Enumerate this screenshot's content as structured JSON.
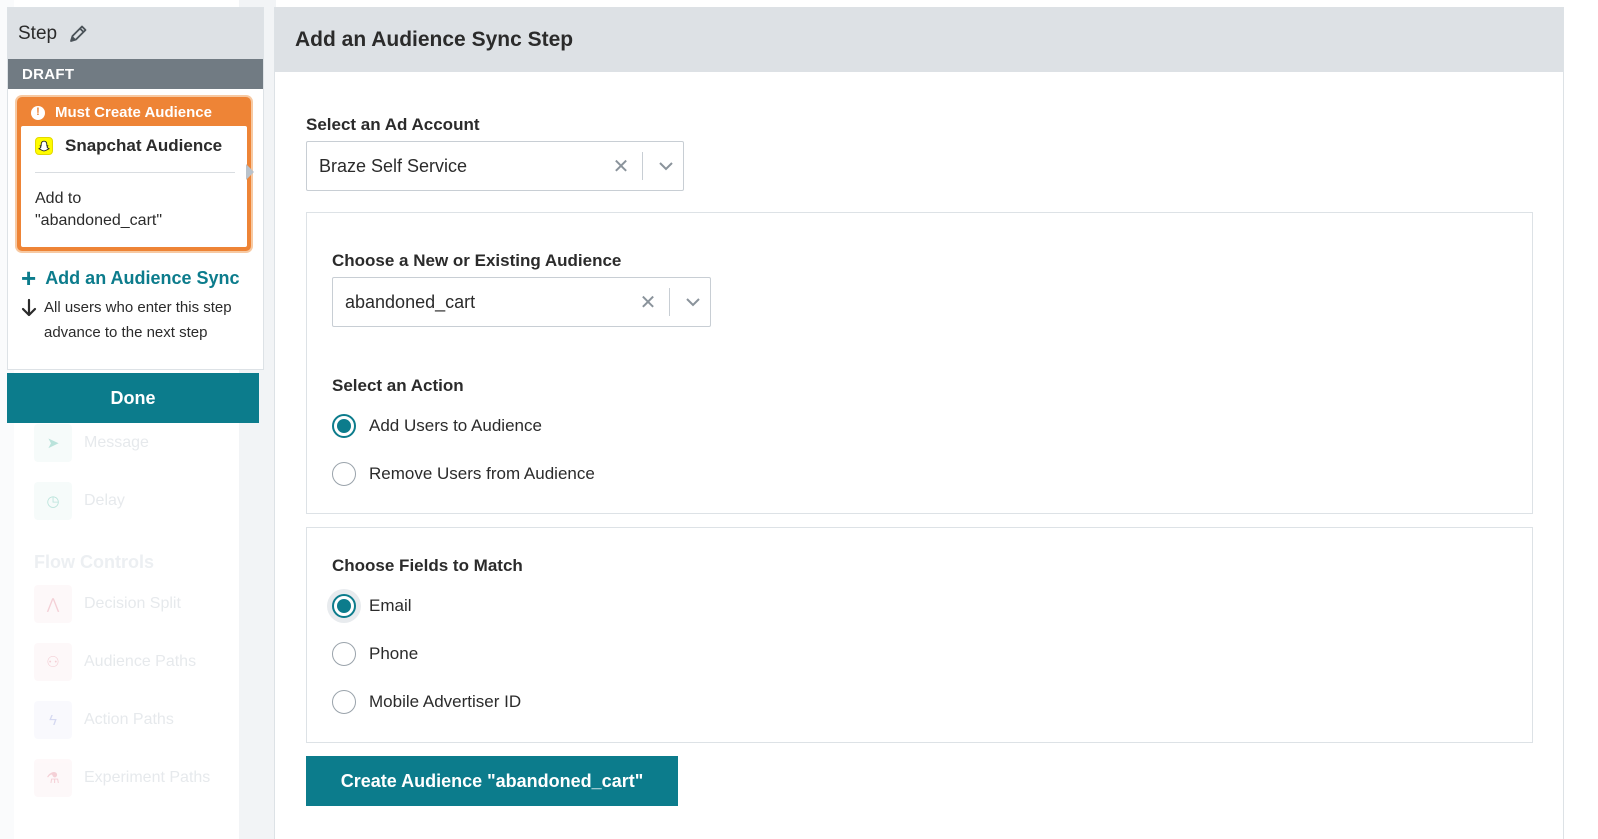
{
  "step_panel": {
    "title": "Step",
    "draft_label": "DRAFT",
    "warning": "Must Create Audience",
    "card_title": "Snapchat Audience",
    "card_description_line1": "Add to",
    "card_description_line2": "\"abandoned_cart\"",
    "add_sync_label": "Add an Audience Sync",
    "advance_text": "All users who enter this step advance to the next step",
    "done_label": "Done"
  },
  "background_items": {
    "message": "Message",
    "delay": "Delay",
    "flow_controls": "Flow Controls",
    "decision_split": "Decision Split",
    "audience_paths": "Audience Paths",
    "action_paths": "Action Paths",
    "experiment_paths": "Experiment Paths"
  },
  "modal": {
    "title": "Add an Audience Sync Step",
    "ad_account": {
      "label": "Select an Ad Account",
      "value": "Braze Self Service"
    },
    "audience": {
      "label": "Choose a New or Existing Audience",
      "value": "abandoned_cart"
    },
    "action": {
      "label": "Select an Action",
      "options": [
        "Add Users to Audience",
        "Remove Users from Audience"
      ],
      "selected": "Add Users to Audience"
    },
    "fields": {
      "label": "Choose Fields to Match",
      "options": [
        "Email",
        "Phone",
        "Mobile Advertiser ID"
      ],
      "selected": "Email"
    },
    "create_button": "Create Audience \"abandoned_cart\""
  },
  "colors": {
    "accent": "#0c7c8c",
    "warning": "#ee8436",
    "header_bg": "#dde1e5",
    "draft_bg": "#717b83"
  }
}
